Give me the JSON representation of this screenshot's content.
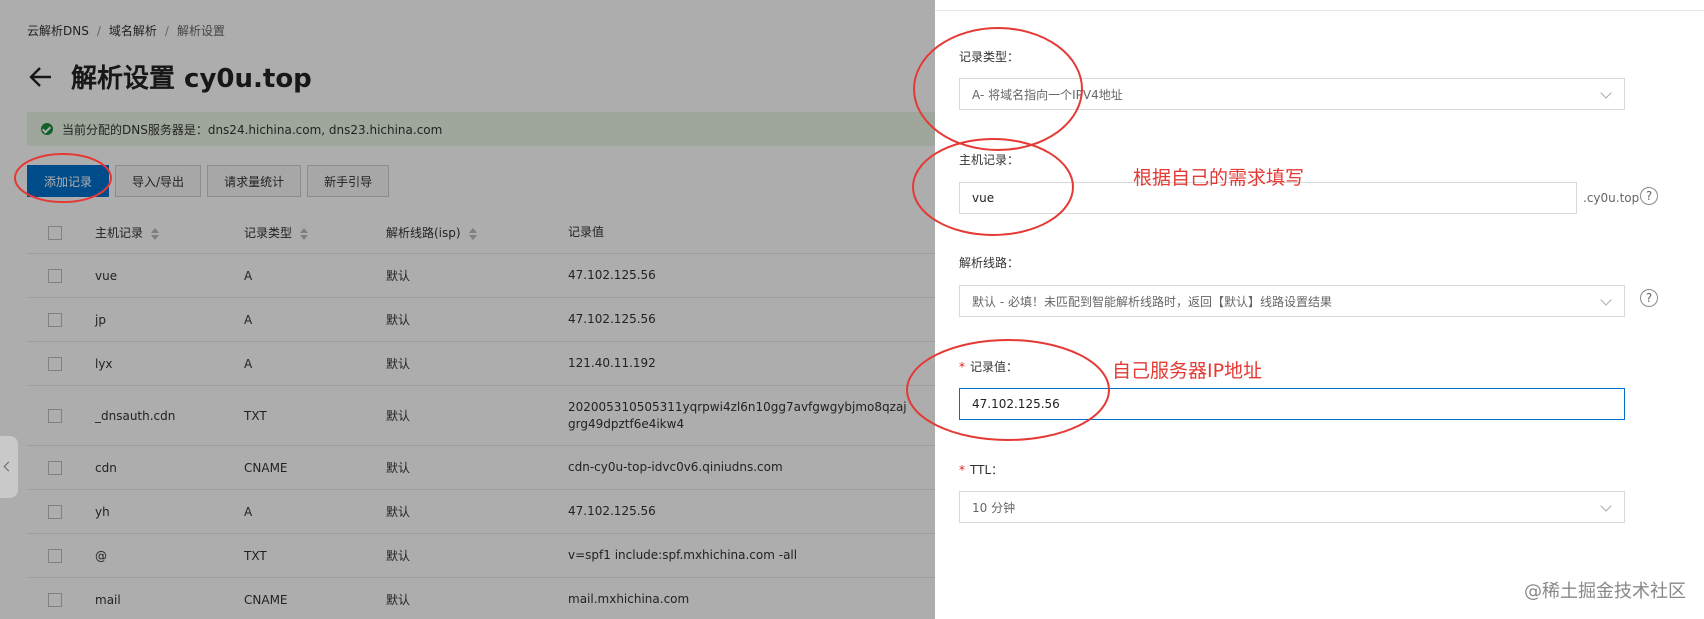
{
  "breadcrumb": [
    "云解析DNS",
    "域名解析",
    "解析设置"
  ],
  "page_title": "解析设置 cy0u.top",
  "notice": "当前分配的DNS服务器是：dns24.hichina.com, dns23.hichina.com",
  "toolbar": {
    "add": "添加记录",
    "import_export": "导入/导出",
    "stats": "请求量统计",
    "guide": "新手引导"
  },
  "table": {
    "headers": {
      "host": "主机记录",
      "type": "记录类型",
      "line": "解析线路(isp)",
      "value": "记录值"
    },
    "rows": [
      {
        "host": "vue",
        "type": "A",
        "line": "默认",
        "value": "47.102.125.56"
      },
      {
        "host": "jp",
        "type": "A",
        "line": "默认",
        "value": "47.102.125.56"
      },
      {
        "host": "lyx",
        "type": "A",
        "line": "默认",
        "value": "121.40.11.192"
      },
      {
        "host": "_dnsauth.cdn",
        "type": "TXT",
        "line": "默认",
        "value": "202005310505311yqrpwi4zl6n10gg7avfgwgybjmo8qzaj grg49dpztf6e4ikw4"
      },
      {
        "host": "cdn",
        "type": "CNAME",
        "line": "默认",
        "value": "cdn-cy0u-top-idvc0v6.qiniudns.com"
      },
      {
        "host": "yh",
        "type": "A",
        "line": "默认",
        "value": "47.102.125.56"
      },
      {
        "host": "@",
        "type": "TXT",
        "line": "默认",
        "value": "v=spf1 include:spf.mxhichina.com -all"
      },
      {
        "host": "mail",
        "type": "CNAME",
        "line": "默认",
        "value": "mail.mxhichina.com"
      }
    ]
  },
  "form": {
    "record_type_label": "记录类型：",
    "record_type_value": "A- 将域名指向一个IPV4地址",
    "host_label": "主机记录：",
    "host_value": "vue",
    "host_suffix": ".cy0u.top",
    "line_label": "解析线路：",
    "line_value": "默认 - 必填！未匹配到智能解析线路时，返回【默认】线路设置结果",
    "value_label": "记录值：",
    "value_value": "47.102.125.56",
    "ttl_label": "TTL：",
    "ttl_value": "10 分钟",
    "required_mark": "*",
    "help_mark": "?"
  },
  "annotations": {
    "host_note": "根据自己的需求填写",
    "value_note": "自己服务器IP地址",
    "color": "#e53935"
  },
  "watermark": "@稀土掘金技术社区",
  "colors": {
    "primary": "#0070cc",
    "notice_bg": "#eaf6e6",
    "success": "#1e8e3e"
  }
}
